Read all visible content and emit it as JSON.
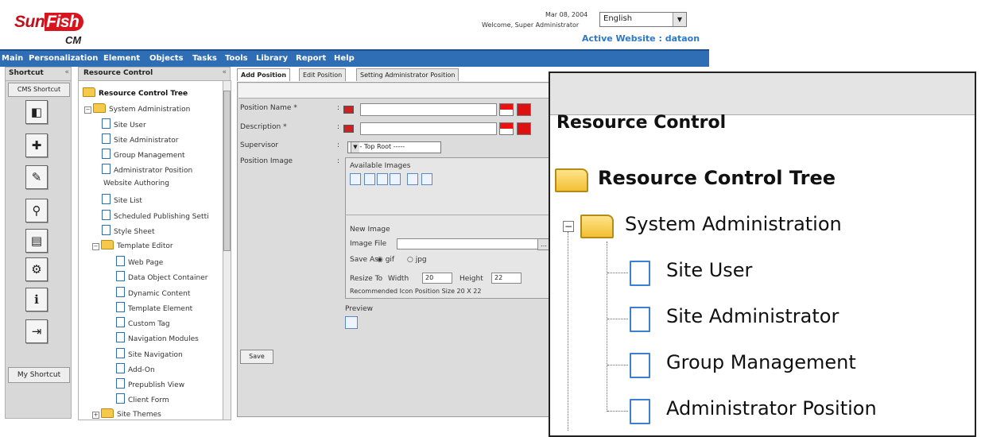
{
  "header": {
    "logo_text_sun": "Sun",
    "logo_text_fish": "Fish",
    "logo_text_cm": "CM",
    "date": "Mar 08, 2004",
    "welcome": "Welcome, Super Administrator",
    "language": "English",
    "active_website": "Active Website : dataon"
  },
  "menu": [
    "Main",
    "Personalization",
    "Element",
    "Objects",
    "Tasks",
    "Tools",
    "Library",
    "Report",
    "Help"
  ],
  "shortcut": {
    "title": "Shortcut",
    "collapse": "«",
    "cms_shortcut": "CMS Shortcut",
    "my_shortcut": "My Shortcut",
    "icons": [
      "shortcut-icon-1",
      "shortcut-icon-2",
      "shortcut-icon-3",
      "shortcut-icon-4",
      "shortcut-icon-5",
      "shortcut-icon-6",
      "shortcut-icon-7",
      "shortcut-icon-8"
    ]
  },
  "tree": {
    "title": "Resource Control",
    "collapse": "«",
    "root": "Resource Control Tree",
    "sys_admin": "System Administration",
    "sys_items": [
      "Site User",
      "Site Administrator",
      "Group Management",
      "Administrator Position"
    ],
    "website_authoring": "Website Authoring",
    "auth_items": [
      "Site List",
      "Scheduled Publishing Setti",
      "Style Sheet"
    ],
    "template_editor": "Template Editor",
    "template_items": [
      "Web Page",
      "Data Object Container",
      "Dynamic Content",
      "Template Element",
      "Custom Tag",
      "Navigation Modules",
      "Site Navigation",
      "Add-On",
      "Prepublish View",
      "Client Form"
    ],
    "site_themes": "Site Themes"
  },
  "tabs": [
    "Add Position",
    "Edit Position",
    "Setting Administrator Position"
  ],
  "form": {
    "position_name_label": "Position Name *",
    "description_label": "Description *",
    "supervisor_label": "Supervisor",
    "position_image_label": "Position Image",
    "colon": ":",
    "supervisor_value": "----- Top Root -----",
    "available_images": "Available Images",
    "new_image": "New Image",
    "image_file": "Image File",
    "save_as": "Save As",
    "save_gif": "gif",
    "save_jpg": "jpg",
    "resize_to": "Resize To",
    "width_label": "Width",
    "width_value": "20",
    "height_label": "Height",
    "height_value": "22",
    "hint": "Recommended Icon Position Size 20 X 22",
    "preview": "Preview",
    "save_button": "Save"
  },
  "zoom": {
    "title": "Resource Control",
    "root": "Resource Control Tree",
    "sys_admin": "System Administration",
    "items": [
      "Site User",
      "Site Administrator",
      "Group Management",
      "Administrator Position"
    ]
  },
  "colors": {
    "menubar": "#2f6eb5",
    "brand_red": "#c0101a",
    "active_site": "#2f78c8"
  }
}
